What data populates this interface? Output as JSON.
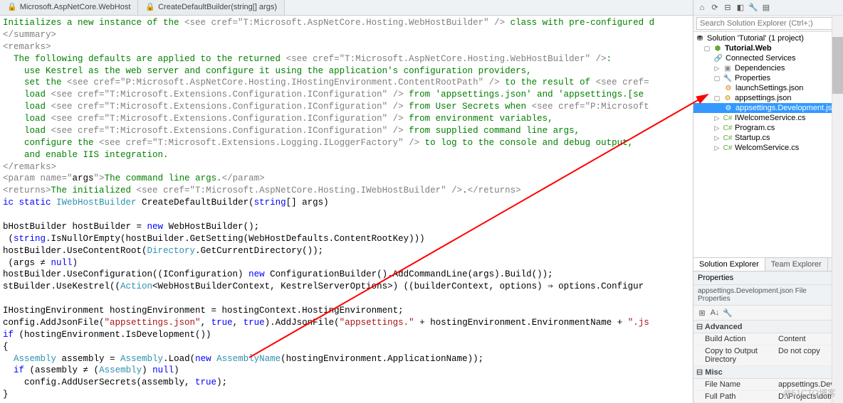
{
  "editor": {
    "tabs": [
      {
        "icon": "🔒",
        "label": "Microsoft.AspNetCore.WebHost"
      },
      {
        "icon": "🔒",
        "label": "CreateDefaultBuilder(string[] args)"
      }
    ],
    "lines": {
      "l1a": "Initializes a new instance of the ",
      "l1b": "<see cref=\"T:Microsoft.AspNetCore.Hosting.WebHostBuilder\" />",
      "l1c": " class with pre-configured d",
      "l2": "</summary>",
      "l3": "<remarks>",
      "l4a": "  The following defaults are applied to the returned ",
      "l4b": "<see cref=\"T:Microsoft.AspNetCore.Hosting.WebHostBuilder\" />",
      "l4c": ":",
      "l5": "    use Kestrel as the web server and configure it using the application's configuration providers,",
      "l6a": "    set the ",
      "l6b": "<see cref=\"P:Microsoft.AspNetCore.Hosting.IHostingEnvironment.ContentRootPath\" />",
      "l6c": " to the result of ",
      "l6d": "<see cref=",
      "l7a": "    load ",
      "l7b": "<see cref=\"T:Microsoft.Extensions.Configuration.IConfiguration\" />",
      "l7c": " from 'appsettings.json' and 'appsettings.[se",
      "l8a": "    load ",
      "l8b": "<see cref=\"T:Microsoft.Extensions.Configuration.IConfiguration\" />",
      "l8c": " from User Secrets when ",
      "l8d": "<see cref=\"P:Microsoft",
      "l9a": "    load ",
      "l9b": "<see cref=\"T:Microsoft.Extensions.Configuration.IConfiguration\" />",
      "l9c": " from environment variables,",
      "l10a": "    load ",
      "l10b": "<see cref=\"T:Microsoft.Extensions.Configuration.IConfiguration\" />",
      "l10c": " from supplied command line args,",
      "l11a": "    configure the ",
      "l11b": "<see cref=\"T:Microsoft.Extensions.Logging.ILoggerFactory\" />",
      "l11c": " to log to the console and debug output,",
      "l12": "    and enable IIS integration.",
      "l13": "</remarks>",
      "l14a": "<param name=\"",
      "l14b": "args",
      "l14c": "\">",
      "l14d": "The command line args.",
      "l14e": "</param>",
      "l15a": "<returns>",
      "l15b": "The initialized ",
      "l15c": "<see cref=\"T:Microsoft.AspNetCore.Hosting.IWebHostBuilder\" />",
      "l15d": ".",
      "l15e": "</returns>",
      "l16ic": "ic",
      "l16static": " static ",
      "l16type": "IWebHostBuilder",
      "l16rest": " CreateDefaultBuilder(",
      "l16string": "string",
      "l16end": "[] args)",
      "l18a": "bHostBuilder hostBuilder = ",
      "l18new": "new",
      "l18b": " WebHostBuilder();",
      "l19a": " (",
      "l19string": "string",
      "l19b": ".IsNullOrEmpty(hostBuilder.GetSetting(WebHostDefaults.ContentRootKey)))",
      "l20a": "hostBuilder.UseContentRoot(",
      "l20dir": "Directory",
      "l20b": ".GetCurrentDirectory());",
      "l21a": " (args ≠ ",
      "l21null": "null",
      "l21b": ")",
      "l22a": "hostBuilder.UseConfiguration((IConfiguration) ",
      "l22new": "new",
      "l22b": " ConfigurationBuilder().AddCommandLine(args).Build());",
      "l23a": "stBuilder.UseKestrel((",
      "l23action": "Action",
      "l23b": "<WebHostBuilderContext, KestrelServerOptions>) ((builderContext, options) ⇒ options.Configur",
      "l25a": "IHostingEnvironment hostingEnvironment = hostingContext.HostingEnvironment;",
      "l26a": "config.AddJsonFile(",
      "l26s1": "\"appsettings.json\"",
      "l26b": ", ",
      "l26true1": "true",
      "l26c": ", ",
      "l26true2": "true",
      "l26d": ").AddJsonFile(",
      "l26s2": "\"appsettings.\"",
      "l26e": " + hostingEnvironment.EnvironmentName + ",
      "l26s3": "\".js",
      "l27a": "if",
      "l27b": " (hostingEnvironment.IsDevelopment())",
      "l28": "{",
      "l29a": "  ",
      "l29asm": "Assembly",
      "l29b": " assembly = ",
      "l29asm2": "Assembly",
      "l29c": ".Load(",
      "l29new": "new",
      "l29d": " ",
      "l29an": "AssemblyName",
      "l29e": "(hostingEnvironment.ApplicationName));",
      "l30a": "  ",
      "l30if": "if",
      "l30b": " (assembly ≠ (",
      "l30asm": "Assembly",
      "l30c": ") ",
      "l30null": "null",
      "l30d": ")",
      "l31a": "    config.AddUserSecrets(assembly, ",
      "l31true": "true",
      "l31b": ");",
      "l32": "}"
    }
  },
  "solution": {
    "searchPlaceholder": "Search Solution Explorer (Ctrl+;)",
    "root": "Solution 'Tutorial' (1 project)",
    "project": "Tutorial.Web",
    "items": {
      "connected": "Connected Services",
      "deps": "Dependencies",
      "props": "Properties",
      "launch": "launchSettings.json",
      "appsettings": "appsettings.json",
      "appsettingsDev": "appsettings.Development.json",
      "iwelcome": "IWelcomeService.cs",
      "program": "Program.cs",
      "startup": "Startup.cs",
      "welcome": "WelcomService.cs"
    },
    "tabs": {
      "sol": "Solution Explorer",
      "team": "Team Explorer"
    }
  },
  "properties": {
    "header": "Properties",
    "subheader": "appsettings.Development.json File Properties",
    "cats": {
      "adv": "Advanced",
      "misc": "Misc"
    },
    "rows": {
      "buildAction": {
        "name": "Build Action",
        "val": "Content"
      },
      "copy": {
        "name": "Copy to Output Directory",
        "val": "Do not copy"
      },
      "fileName": {
        "name": "File Name",
        "val": "appsettings.Develop"
      },
      "fullPath": {
        "name": "Full Path",
        "val": "D:\\Projects\\dotnet\\T"
      }
    }
  },
  "watermark": "@51CTO博客"
}
